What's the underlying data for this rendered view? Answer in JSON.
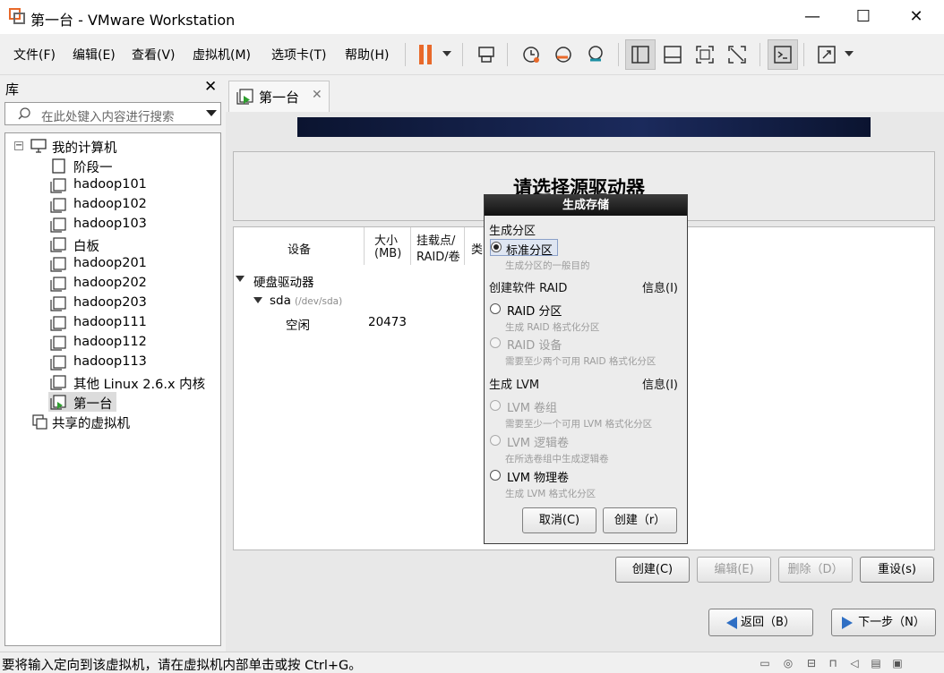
{
  "window": {
    "title": "第一台 - VMware Workstation",
    "controls": {
      "minimize": "—",
      "maximize": "☐",
      "close": "✕"
    }
  },
  "menu": [
    "文件(F)",
    "编辑(E)",
    "查看(V)",
    "虚拟机(M)",
    "选项卡(T)",
    "帮助(H)"
  ],
  "toolbar": {
    "accent": "#e8692a"
  },
  "library": {
    "title": "库",
    "search_placeholder": "在此处键入内容进行搜索",
    "root": "我的计算机",
    "items": [
      "阶段一",
      "hadoop101",
      "hadoop102",
      "hadoop103",
      "白板",
      "hadoop201",
      "hadoop202",
      "hadoop203",
      "hadoop111",
      "hadoop112",
      "hadoop113",
      "其他 Linux 2.6.x 内核",
      "第一台"
    ],
    "shared": "共享的虚拟机",
    "selected": "第一台"
  },
  "tab": {
    "label": "第一台"
  },
  "installer": {
    "heading": "请选择源驱动器",
    "columns": {
      "device": "设备",
      "size_line1": "大小",
      "size_line2": "(MB)",
      "mount_line1": "挂载点/",
      "mount_line2": "RAID/卷",
      "type": "类"
    },
    "group": "硬盘驱动器",
    "disk": {
      "name": "sda",
      "path": "(/dev/sda)"
    },
    "free_row": {
      "label": "空闲",
      "size": "20473"
    },
    "buttons": {
      "create": "创建(C)",
      "edit": "编辑(E)",
      "delete": "删除（D）",
      "reset": "重设(s)"
    },
    "nav": {
      "back": "返回（B）",
      "next": "下一步（N）"
    }
  },
  "dialog": {
    "title": "生成存储",
    "sections": [
      {
        "label": "生成分区",
        "info": ""
      },
      {
        "label": "创建软件 RAID",
        "info": "信息(I)"
      },
      {
        "label": "生成 LVM",
        "info": "信息(I)"
      }
    ],
    "options": [
      {
        "label": "标准分区",
        "desc": "生成分区的一般目的",
        "checked": true,
        "disabled": false
      },
      {
        "label": "RAID 分区",
        "desc": "生成 RAID 格式化分区",
        "checked": false,
        "disabled": false
      },
      {
        "label": "RAID 设备",
        "desc": "需要至少两个可用 RAID 格式化分区",
        "checked": false,
        "disabled": true
      },
      {
        "label": "LVM 卷组",
        "desc": "需要至少一个可用 LVM 格式化分区",
        "checked": false,
        "disabled": true
      },
      {
        "label": "LVM 逻辑卷",
        "desc": "在所选卷组中生成逻辑卷",
        "checked": false,
        "disabled": true
      },
      {
        "label": "LVM 物理卷",
        "desc": "生成 LVM 格式化分区",
        "checked": false,
        "disabled": false
      }
    ],
    "cancel": "取消(C)",
    "create": "创建（r）"
  },
  "status": {
    "message": "要将输入定向到该虚拟机，请在虚拟机内部单击或按 Ctrl+G。"
  }
}
